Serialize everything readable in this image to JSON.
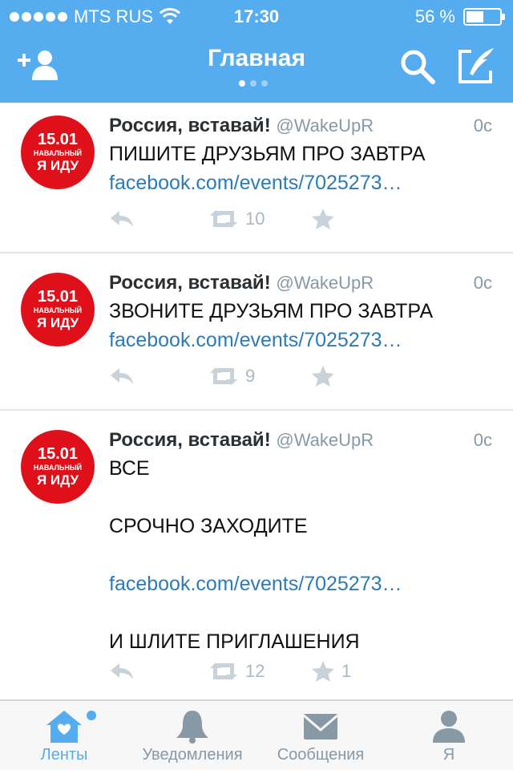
{
  "status_bar": {
    "carrier": "MTS RUS",
    "time": "17:30",
    "battery_text": "56 %",
    "battery_level": 0.56
  },
  "header": {
    "title": "Главная",
    "page_indicator": {
      "count": 3,
      "active": 0
    },
    "icons": [
      "add-user-icon",
      "search-icon",
      "compose-icon"
    ]
  },
  "tweets": [
    {
      "name": "Россия, вставай!",
      "handle": "@WakeUpR",
      "time": "0с",
      "avatar": {
        "date": "15.01",
        "name": "НАВАЛЬНЫЙ",
        "slogan": "Я ИДУ"
      },
      "lines": [
        {
          "text": "ПИШИТЕ ДРУЗЬЯМ ПРО ЗАВТРА",
          "link": false
        },
        {
          "text": "facebook.com/events/7025273…",
          "link": true
        }
      ],
      "retweets": "10",
      "favorites": ""
    },
    {
      "name": "Россия, вставай!",
      "handle": "@WakeUpR",
      "time": "0с",
      "avatar": {
        "date": "15.01",
        "name": "НАВАЛЬНЫЙ",
        "slogan": "Я ИДУ"
      },
      "lines": [
        {
          "text": "ЗВОНИТЕ ДРУЗЬЯМ ПРО ЗАВТРА",
          "link": false
        },
        {
          "text": "facebook.com/events/7025273…",
          "link": true
        }
      ],
      "retweets": "9",
      "favorites": ""
    },
    {
      "name": "Россия, вставай!",
      "handle": "@WakeUpR",
      "time": "0с",
      "avatar": {
        "date": "15.01",
        "name": "НАВАЛЬНЫЙ",
        "slogan": "Я ИДУ"
      },
      "lines": [
        {
          "text": "ВСЕ",
          "link": false
        },
        {
          "text": "",
          "link": false
        },
        {
          "text": "СРОЧНО ЗАХОДИТЕ",
          "link": false
        },
        {
          "text": "",
          "link": false
        },
        {
          "text": "facebook.com/events/7025273…",
          "link": true
        },
        {
          "text": "",
          "link": false
        },
        {
          "text": "И ШЛИТЕ ПРИГЛАШЕНИЯ",
          "link": false
        }
      ],
      "retweets": "12",
      "favorites": "1"
    }
  ],
  "tabbar": {
    "tabs": [
      {
        "label": "Ленты",
        "icon": "home-icon",
        "active": true,
        "badge": true
      },
      {
        "label": "Уведомления",
        "icon": "bell-icon",
        "active": false,
        "badge": false
      },
      {
        "label": "Сообщения",
        "icon": "envelope-icon",
        "active": false,
        "badge": false
      },
      {
        "label": "Я",
        "icon": "profile-icon",
        "active": false,
        "badge": false
      }
    ]
  },
  "colors": {
    "brand": "#55acee",
    "link": "#2b7bb9",
    "muted": "#8899a6",
    "avatar_red": "#e0101a"
  }
}
